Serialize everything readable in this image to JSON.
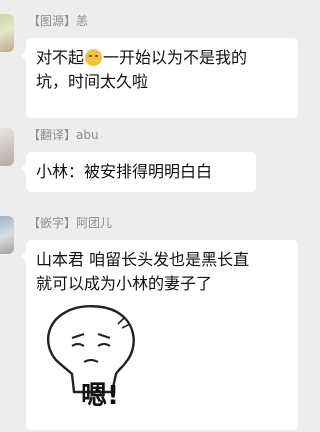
{
  "messages": [
    {
      "sender": "【图源】恙",
      "lines_before_emoji": "对不起",
      "emoji": "sad-face-emoji",
      "lines_after_emoji": "一开始以为不是我的",
      "line2": "坑，时间太久啦"
    },
    {
      "sender": "【翻译】abu",
      "line1": "小林：被安排得明明白白"
    },
    {
      "sender": "【嵌字】阿团儿",
      "line1": "山本君 咱留长头发也是黑长直",
      "line2": "就可以成为小林的妻子了",
      "sticker_text": "嗯!"
    }
  ]
}
